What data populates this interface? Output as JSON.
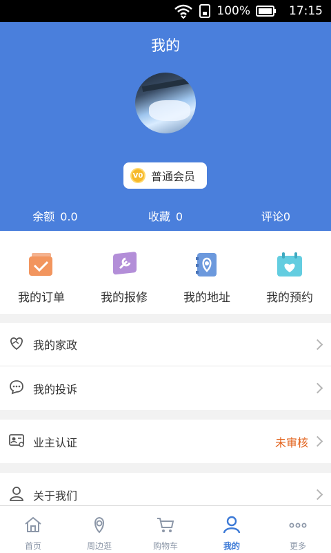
{
  "status_bar": {
    "battery": "100%",
    "time": "17:15"
  },
  "header": {
    "title": "我的",
    "member_level": "普通会员",
    "vip_badge": "V0",
    "stats": [
      {
        "label": "余额",
        "value": "0.0"
      },
      {
        "label": "收藏",
        "value": "0"
      },
      {
        "label": "评论",
        "value": "0"
      }
    ]
  },
  "quick_actions": [
    {
      "label": "我的订单",
      "icon": "order-icon"
    },
    {
      "label": "我的报修",
      "icon": "repair-icon"
    },
    {
      "label": "我的地址",
      "icon": "address-icon"
    },
    {
      "label": "我的预约",
      "icon": "appointment-icon"
    }
  ],
  "menu": {
    "housekeeping": "我的家政",
    "complaint": "我的投诉",
    "owner_verify": "业主认证",
    "owner_verify_status": "未审核",
    "about": "关于我们"
  },
  "tabs": [
    {
      "label": "首页",
      "icon": "home-icon"
    },
    {
      "label": "周边逛",
      "icon": "location-icon"
    },
    {
      "label": "购物车",
      "icon": "cart-icon"
    },
    {
      "label": "我的",
      "icon": "user-icon"
    },
    {
      "label": "更多",
      "icon": "more-icon"
    }
  ],
  "colors": {
    "primary": "#4a7fdc",
    "warning": "#e2621b",
    "active_tab": "#3b79d6"
  }
}
